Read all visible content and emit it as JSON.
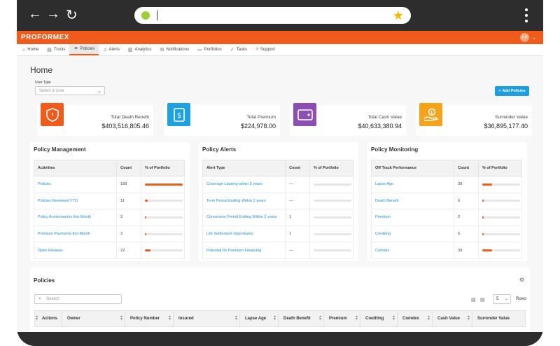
{
  "brand": "PROFORMEX",
  "user_initials": "KP",
  "nav": [
    {
      "label": "Home",
      "icon": "home-icon",
      "glyph": "⌂"
    },
    {
      "label": "Trusts",
      "icon": "document-icon",
      "glyph": "▤"
    },
    {
      "label": "Policies",
      "icon": "umbrella-icon",
      "glyph": "☂"
    },
    {
      "label": "Alerts",
      "icon": "bell-icon",
      "glyph": "♫"
    },
    {
      "label": "Analytics",
      "icon": "chart-icon",
      "glyph": "▥"
    },
    {
      "label": "Notifications",
      "icon": "notification-icon",
      "glyph": "✉"
    },
    {
      "label": "Portfolios",
      "icon": "folder-icon",
      "glyph": "▭"
    },
    {
      "label": "Tasks",
      "icon": "check-icon",
      "glyph": "✓"
    },
    {
      "label": "Support",
      "icon": "support-icon",
      "glyph": "?"
    }
  ],
  "page": {
    "title": "Home",
    "user_type_label": "User Type",
    "select_placeholder": "Select a User",
    "add_button": "Add Policies"
  },
  "stats": [
    {
      "label": "Total Death Benefit",
      "value": "$403,516,805.46",
      "color": "#f05a1a",
      "icon": "shield-icon"
    },
    {
      "label": "Total Premium",
      "value": "$224,978.00",
      "color": "#1da1e0",
      "icon": "dollar-document-icon"
    },
    {
      "label": "Total Cash Value",
      "value": "$40,633,380.94",
      "color": "#8a4fb0",
      "icon": "wallet-icon"
    },
    {
      "label": "Surrender Value",
      "value": "$36,895,177.40",
      "color": "#f5a31a",
      "icon": "hand-coin-icon"
    }
  ],
  "panels": [
    {
      "title": "Policy Management",
      "headers": [
        "Activities",
        "Count",
        "% of Portfolio"
      ],
      "rows": [
        {
          "label": "Policies",
          "count": "158",
          "pct": 100
        },
        {
          "label": "Policies Reviewed YTD",
          "count": "11",
          "pct": 7
        },
        {
          "label": "Policy Anniversaries this Month",
          "count": "2",
          "pct": 1
        },
        {
          "label": "Premium Payments this Month",
          "count": "3",
          "pct": 2
        },
        {
          "label": "Open Reviews",
          "count": "22",
          "pct": 14
        }
      ]
    },
    {
      "title": "Policy Alerts",
      "headers": [
        "Alert Type",
        "Count",
        "% of Portfolio"
      ],
      "rows": [
        {
          "label": "Coverage Lapsing within 5 years",
          "count": "—",
          "pct": 0
        },
        {
          "label": "Term Period Ending Within 2 years",
          "count": "—",
          "pct": 0
        },
        {
          "label": "Conversion Period Ending Within 2 years",
          "count": "1",
          "pct": 0
        },
        {
          "label": "Life Settlement Opportunity",
          "count": "1",
          "pct": 0
        },
        {
          "label": "Potential for Premium Financing",
          "count": "—",
          "pct": 0
        }
      ]
    },
    {
      "title": "Policy Monitoring",
      "headers": [
        "Off Track Performance",
        "Count",
        "% of Portfolio"
      ],
      "rows": [
        {
          "label": "Lapse Age",
          "count": "39",
          "pct": 25
        },
        {
          "label": "Death Benefit",
          "count": "6",
          "pct": 4
        },
        {
          "label": "Premium",
          "count": "2",
          "pct": 1
        },
        {
          "label": "Crediting",
          "count": "6",
          "pct": 4
        },
        {
          "label": "Comdex",
          "count": "39",
          "pct": 25
        }
      ]
    }
  ],
  "policies": {
    "title": "Policies",
    "search_placeholder": "Search",
    "rows_value": "5",
    "rows_label": "Rows",
    "columns": [
      "Actions",
      "Owner",
      "Policy Number",
      "Insured",
      "Lapse Age",
      "Death Benefit",
      "Premium",
      "Crediting",
      "Comdex",
      "Cash Value",
      "Surrender Value"
    ]
  }
}
